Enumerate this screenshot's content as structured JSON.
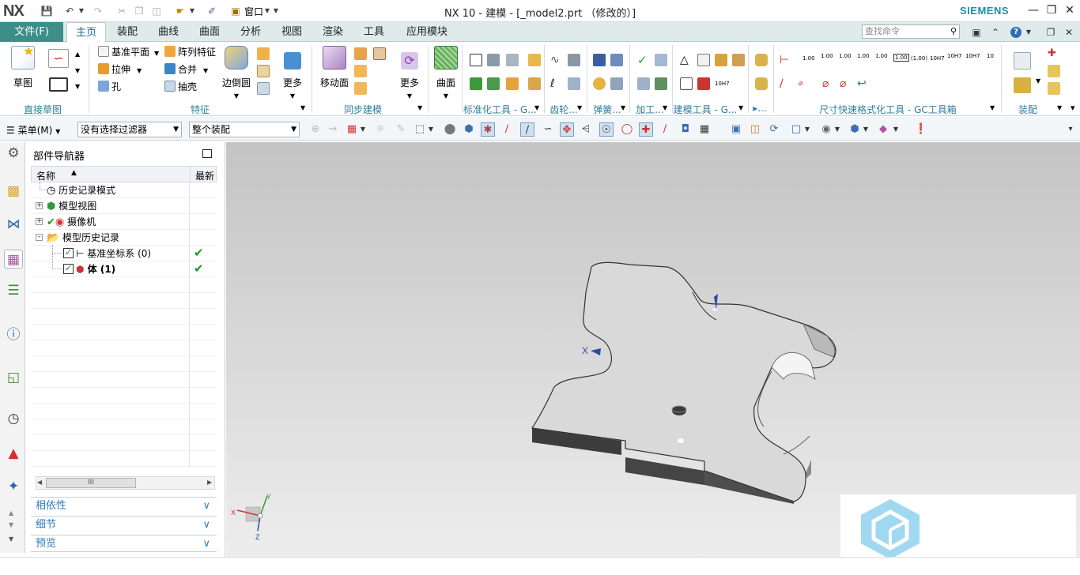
{
  "titlebar": {
    "logo": "NX",
    "title": "NX 10 - 建模 - [_model2.prt （修改的）]",
    "window_menu": "窗口",
    "brand": "SIEMENS"
  },
  "tabs": {
    "file": "文件(F)",
    "items": [
      "主页",
      "装配",
      "曲线",
      "曲面",
      "分析",
      "视图",
      "渲染",
      "工具",
      "应用模块"
    ],
    "active": "主页",
    "search_placeholder": "查找命令"
  },
  "ribbon": {
    "sketch": "草图",
    "groups": {
      "direct_sketch": "直接草图",
      "feature": "特征",
      "sync": "同步建模",
      "std_tools": "标准化工具 - G...",
      "gear": "齿轮...",
      "spring": "弹簧...",
      "machining": "加工...",
      "modeling_tools": "建模工具 - G...",
      "more": "▸...",
      "dim_tools": "尺寸快速格式化工具 - GC工具箱",
      "assembly": "装配"
    },
    "feature_buttons": {
      "datum_plane": "基准平面",
      "pattern": "阵列特征",
      "extrude": "拉伸",
      "unite": "合并",
      "hole": "孔",
      "shell": "抽壳",
      "edge_blend": "边倒圆",
      "more": "更多"
    },
    "sync_buttons": {
      "move_face": "移动面",
      "more": "更多"
    },
    "surface": "曲面",
    "dim_labels": [
      "1.00",
      "1.00",
      "1.00",
      "1.00",
      "1.00",
      "1.00",
      "(1.00)",
      "10H7",
      "10H7",
      "10H7",
      "10"
    ]
  },
  "toolbar2": {
    "menu": "菜单(M)",
    "filter": "没有选择过滤器",
    "scope": "整个装配"
  },
  "navigator": {
    "title": "部件导航器",
    "col_name": "名称",
    "col_latest": "最新",
    "rows": [
      {
        "label": "历史记录模式",
        "latest": ""
      },
      {
        "label": "模型视图",
        "latest": ""
      },
      {
        "label": "摄像机",
        "latest": ""
      },
      {
        "label": "模型历史记录",
        "latest": ""
      },
      {
        "label": "基准坐标系 (0)",
        "latest": "✔"
      },
      {
        "label": "体 (1)",
        "latest": "✔"
      }
    ],
    "scroll_thumb": "III",
    "panels": [
      "相依性",
      "细节",
      "预览"
    ]
  },
  "viewport": {
    "x_label": "X",
    "triad": {
      "x": "X",
      "y": "Y",
      "z": "Z"
    }
  },
  "colors": {
    "file_tab": "#3d8e88",
    "group_label": "#2e7e9e",
    "panel_text": "#2b7cbf",
    "check": "#1e9a1e"
  }
}
